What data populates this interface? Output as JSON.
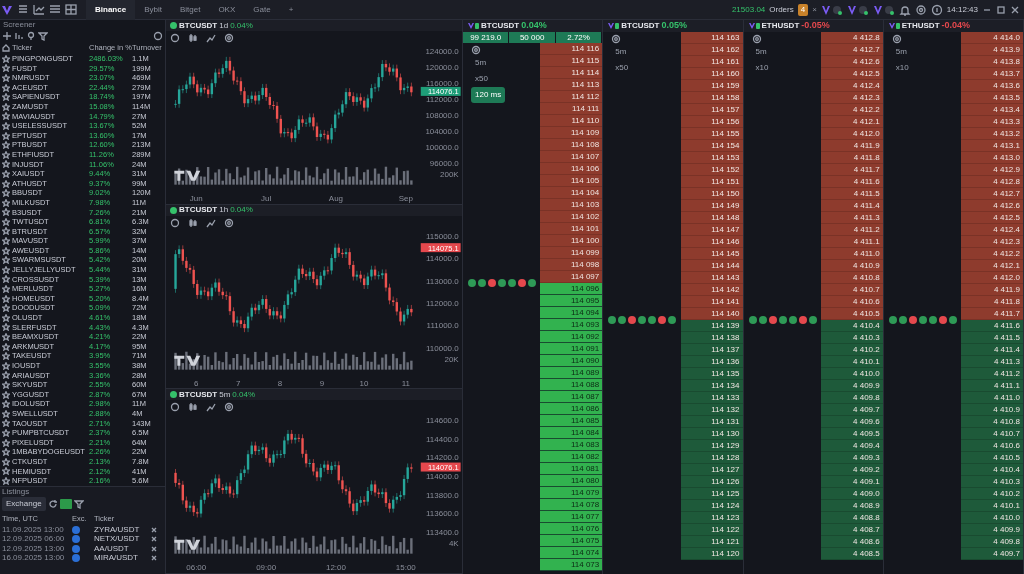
{
  "top_bar": {
    "tabs": [
      {
        "label": "Binance",
        "selected": true
      },
      {
        "label": "Bybit",
        "selected": false
      },
      {
        "label": "Bitget",
        "selected": false
      },
      {
        "label": "OKX",
        "selected": false
      },
      {
        "label": "Gate",
        "selected": false
      }
    ],
    "add_tab": "+",
    "balance": "21503.04",
    "orders_label": "Orders",
    "orders_count": "4",
    "orders_close": "×",
    "time": "14:12:43"
  },
  "screener": {
    "title": "Screener",
    "columns": [
      "Ticker",
      "Change in %",
      "Turnover"
    ],
    "rows": [
      {
        "ticker": "PINGPONGUSDT",
        "change": "2486.03%",
        "turnover": "1.1M"
      },
      {
        "ticker": "FUSDT",
        "change": "29.57%",
        "turnover": "199M"
      },
      {
        "ticker": "NMRUSDT",
        "change": "23.07%",
        "turnover": "469M"
      },
      {
        "ticker": "ACEUSDT",
        "change": "22.44%",
        "turnover": "279M"
      },
      {
        "ticker": "SAPIENUSDT",
        "change": "18.74%",
        "turnover": "197M"
      },
      {
        "ticker": "ZAMUSDT",
        "change": "15.08%",
        "turnover": "114M"
      },
      {
        "ticker": "MAVIAUSDT",
        "change": "14.79%",
        "turnover": "27M"
      },
      {
        "ticker": "USELESSUSDT",
        "change": "13.67%",
        "turnover": "52M"
      },
      {
        "ticker": "EPTUSDT",
        "change": "13.60%",
        "turnover": "17M"
      },
      {
        "ticker": "PTBUSDT",
        "change": "12.60%",
        "turnover": "213M"
      },
      {
        "ticker": "ETHFIUSDT",
        "change": "11.26%",
        "turnover": "289M"
      },
      {
        "ticker": "INJUSDT",
        "change": "11.06%",
        "turnover": "24M"
      },
      {
        "ticker": "XAIUSDT",
        "change": "9.44%",
        "turnover": "31M"
      },
      {
        "ticker": "ATHUSDT",
        "change": "9.37%",
        "turnover": "99M"
      },
      {
        "ticker": "BBUSDT",
        "change": "9.02%",
        "turnover": "120M"
      },
      {
        "ticker": "MILKUSDT",
        "change": "7.98%",
        "turnover": "11M"
      },
      {
        "ticker": "B3USDT",
        "change": "7.26%",
        "turnover": "21M"
      },
      {
        "ticker": "TWTUSDT",
        "change": "6.81%",
        "turnover": "6.3M"
      },
      {
        "ticker": "BTRUSDT",
        "change": "6.57%",
        "turnover": "32M"
      },
      {
        "ticker": "MAVUSDT",
        "change": "5.99%",
        "turnover": "37M"
      },
      {
        "ticker": "AWEUSDT",
        "change": "5.86%",
        "turnover": "14M"
      },
      {
        "ticker": "SWARMSUSDT",
        "change": "5.42%",
        "turnover": "20M"
      },
      {
        "ticker": "JELLYJELLYUSDT",
        "change": "5.44%",
        "turnover": "31M"
      },
      {
        "ticker": "CROSSUSDT",
        "change": "5.39%",
        "turnover": "13M"
      },
      {
        "ticker": "MERLUSDT",
        "change": "5.27%",
        "turnover": "16M"
      },
      {
        "ticker": "HOMEUSDT",
        "change": "5.20%",
        "turnover": "8.4M"
      },
      {
        "ticker": "DOODUSDT",
        "change": "5.09%",
        "turnover": "72M"
      },
      {
        "ticker": "OLUSDT",
        "change": "4.61%",
        "turnover": "18M"
      },
      {
        "ticker": "SLERFUSDT",
        "change": "4.43%",
        "turnover": "4.3M"
      },
      {
        "ticker": "BEAMXUSDT",
        "change": "4.21%",
        "turnover": "22M"
      },
      {
        "ticker": "ARKMUSDT",
        "change": "4.17%",
        "turnover": "95M"
      },
      {
        "ticker": "TAKEUSDT",
        "change": "3.95%",
        "turnover": "71M"
      },
      {
        "ticker": "IOUSDT",
        "change": "3.55%",
        "turnover": "38M"
      },
      {
        "ticker": "ARIAUSDT",
        "change": "3.36%",
        "turnover": "28M"
      },
      {
        "ticker": "SKYUSDT",
        "change": "2.55%",
        "turnover": "60M"
      },
      {
        "ticker": "YGGUSDT",
        "change": "2.87%",
        "turnover": "67M"
      },
      {
        "ticker": "IDOLUSDT",
        "change": "2.98%",
        "turnover": "11M"
      },
      {
        "ticker": "SWELLUSDT",
        "change": "2.88%",
        "turnover": "4M"
      },
      {
        "ticker": "TAOUSDT",
        "change": "2.71%",
        "turnover": "143M"
      },
      {
        "ticker": "PUMPBTCUSDT",
        "change": "2.37%",
        "turnover": "6.5M"
      },
      {
        "ticker": "PIXELUSDT",
        "change": "2.21%",
        "turnover": "64M"
      },
      {
        "ticker": "1MBABYDOGEUSDT",
        "change": "2.26%",
        "turnover": "22M"
      },
      {
        "ticker": "CTKUSDT",
        "change": "2.13%",
        "turnover": "7.8M"
      },
      {
        "ticker": "HEMIUSDT",
        "change": "2.12%",
        "turnover": "41M"
      },
      {
        "ticker": "NFPUSDT",
        "change": "2.16%",
        "turnover": "5.6M"
      }
    ]
  },
  "listings": {
    "title": "Listings",
    "filter": "Exchange",
    "columns": [
      "Time, UTC",
      "Exc.",
      "Ticker"
    ],
    "rows": [
      {
        "time": "11.09.2025 13:00",
        "ticker": "ZYRA/USDT"
      },
      {
        "time": "12.09.2025 06:00",
        "ticker": "NETX/USDT"
      },
      {
        "time": "12.09.2025 13:00",
        "ticker": "AA/USDT"
      },
      {
        "time": "16.09.2025 13:00",
        "ticker": "MIRA/USDT"
      }
    ]
  },
  "charts": [
    {
      "symbol": "BTCUSDT",
      "interval": "1d",
      "change": "0.04%",
      "yticks": [
        "124000.0",
        "120000.0",
        "116000.0",
        "112000.0",
        "108000.0",
        "104000.0",
        "100000.0",
        "96000.0"
      ],
      "last_price": "114076.1",
      "volume_tick": "200K",
      "xticks": [
        "Jun",
        "Jul",
        "Aug",
        "Sep"
      ]
    },
    {
      "symbol": "BTCUSDT",
      "interval": "1h",
      "change": "0.04%",
      "yticks": [
        "115000.0",
        "114000.0",
        "113000.0",
        "112000.0",
        "111000.0",
        "110000.0"
      ],
      "last_price": "114075.1",
      "volume_tick": "20K",
      "xticks": [
        "6",
        "7",
        "8",
        "9",
        "10",
        "11"
      ]
    },
    {
      "symbol": "BTCUSDT",
      "interval": "5m",
      "change": "0.04%",
      "yticks": [
        "114600.0",
        "114400.0",
        "114200.0",
        "114000.0",
        "113800.0",
        "113600.0",
        "113400.0"
      ],
      "last_price": "114076.1",
      "volume_tick": "4K",
      "xticks": [
        "06:00",
        "09:00",
        "12:00",
        "15:00"
      ]
    }
  ],
  "ladders": [
    {
      "symbol": "BTCUSDT",
      "change": "0.04%",
      "color": "#35c26b",
      "bids_bright": true,
      "summary": [
        "99 219.0",
        "50 000",
        "2.72%"
      ],
      "controls": [
        "5m",
        "x50",
        "120 ms"
      ],
      "asks": [
        "114 116",
        "114 115",
        "114 114",
        "114 113",
        "114 112",
        "114 111",
        "114 110",
        "114 109",
        "114 108",
        "114 107",
        "114 106",
        "114 105",
        "114 104",
        "114 103",
        "114 102",
        "114 101",
        "114 100",
        "114 099",
        "114 098",
        "114 097"
      ],
      "bids": [
        "114 096",
        "114 095",
        "114 094",
        "114 093",
        "114 092",
        "114 091",
        "114 090",
        "114 089",
        "114 088",
        "114 087",
        "114 086",
        "114 085",
        "114 084",
        "114 083",
        "114 082",
        "114 081",
        "114 080",
        "114 079",
        "114 078",
        "114 077",
        "114 076",
        "114 075",
        "114 074",
        "114 073"
      ]
    },
    {
      "symbol": "BTCUSDT",
      "change": "0.05%",
      "color": "#35c26b",
      "bids_bright": false,
      "controls": [
        "5m",
        "x50"
      ],
      "asks": [
        "114 163",
        "114 162",
        "114 161",
        "114 160",
        "114 159",
        "114 158",
        "114 157",
        "114 156",
        "114 155",
        "114 154",
        "114 153",
        "114 152",
        "114 151",
        "114 150",
        "114 149",
        "114 148",
        "114 147",
        "114 146",
        "114 145",
        "114 144",
        "114 143",
        "114 142",
        "114 141",
        "114 140"
      ],
      "bids": [
        "114 139",
        "114 138",
        "114 137",
        "114 136",
        "114 135",
        "114 134",
        "114 133",
        "114 132",
        "114 131",
        "114 130",
        "114 129",
        "114 128",
        "114 127",
        "114 126",
        "114 125",
        "114 124",
        "114 123",
        "114 122",
        "114 121",
        "114 120"
      ]
    },
    {
      "symbol": "ETHUSDT",
      "change": "-0.05%",
      "color": "#e5484d",
      "bids_bright": false,
      "controls": [
        "5m",
        "x10"
      ],
      "asks": [
        "4 412.8",
        "4 412.7",
        "4 412.6",
        "4 412.5",
        "4 412.4",
        "4 412.3",
        "4 412.2",
        "4 412.1",
        "4 412.0",
        "4 411.9",
        "4 411.8",
        "4 411.7",
        "4 411.6",
        "4 411.5",
        "4 411.4",
        "4 411.3",
        "4 411.2",
        "4 411.1",
        "4 411.0",
        "4 410.9",
        "4 410.8",
        "4 410.7",
        "4 410.6",
        "4 410.5"
      ],
      "bids": [
        "4 410.4",
        "4 410.3",
        "4 410.2",
        "4 410.1",
        "4 410.0",
        "4 409.9",
        "4 409.8",
        "4 409.7",
        "4 409.6",
        "4 409.5",
        "4 409.4",
        "4 409.3",
        "4 409.2",
        "4 409.1",
        "4 409.0",
        "4 408.9",
        "4 408.8",
        "4 408.7",
        "4 408.6",
        "4 408.5"
      ]
    },
    {
      "symbol": "ETHUSDT",
      "change": "-0.04%",
      "color": "#e5484d",
      "bids_bright": false,
      "controls": [
        "5m",
        "x10"
      ],
      "asks": [
        "4 414.0",
        "4 413.9",
        "4 413.8",
        "4 413.7",
        "4 413.6",
        "4 413.5",
        "4 413.4",
        "4 413.3",
        "4 413.2",
        "4 413.1",
        "4 413.0",
        "4 412.9",
        "4 412.8",
        "4 412.7",
        "4 412.6",
        "4 412.5",
        "4 412.4",
        "4 412.3",
        "4 412.2",
        "4 412.1",
        "4 412.0",
        "4 411.9",
        "4 411.8",
        "4 411.7"
      ],
      "bids": [
        "4 411.6",
        "4 411.5",
        "4 411.4",
        "4 411.3",
        "4 411.2",
        "4 411.1",
        "4 411.0",
        "4 410.9",
        "4 410.8",
        "4 410.7",
        "4 410.6",
        "4 410.5",
        "4 410.4",
        "4 410.3",
        "4 410.2",
        "4 410.1",
        "4 410.0",
        "4 409.9",
        "4 409.8",
        "4 409.7"
      ]
    }
  ]
}
